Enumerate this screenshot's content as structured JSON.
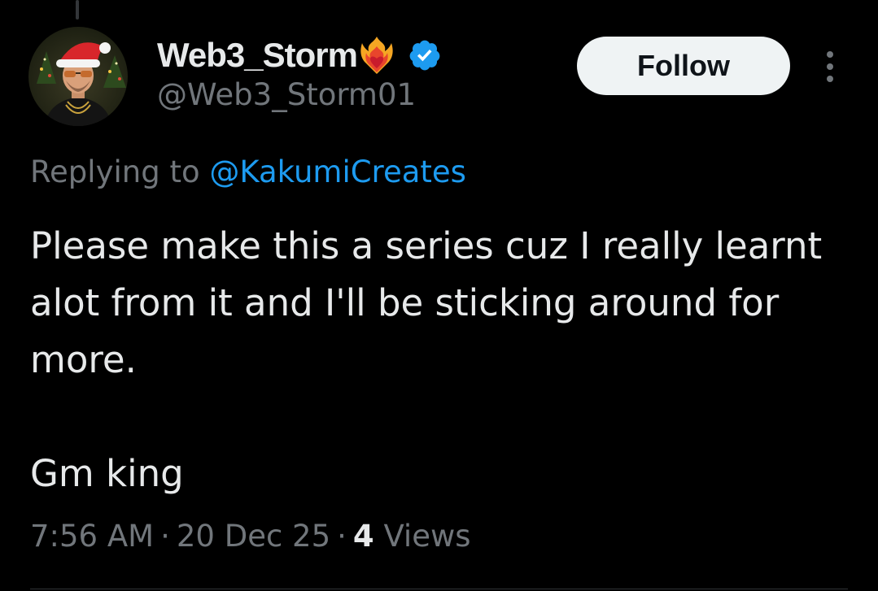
{
  "tweet": {
    "author": {
      "display_name": "Web3_Storm",
      "handle": "@Web3_Storm01",
      "verified": true,
      "name_emoji": "heart-on-fire-icon",
      "avatar": "avatar-santa-hat-man"
    },
    "follow_label": "Follow",
    "reply_prefix": "Replying to",
    "reply_to": "@KakumiCreates",
    "body_paragraphs": [
      "Please make this a series cuz I really learnt alot from it and I'll be sticking around for more.",
      "Gm king"
    ],
    "time": "7:56 AM",
    "date": "20 Dec 25",
    "separator": "·",
    "views_count": "4",
    "views_label": "Views"
  },
  "colors": {
    "background": "#000000",
    "primary_text": "#e7e9ea",
    "secondary_text": "#71767b",
    "link": "#1d9bf0",
    "verified_badge": "#1d9bf0",
    "follow_bg": "#eff3f4",
    "follow_text": "#0f1419"
  }
}
